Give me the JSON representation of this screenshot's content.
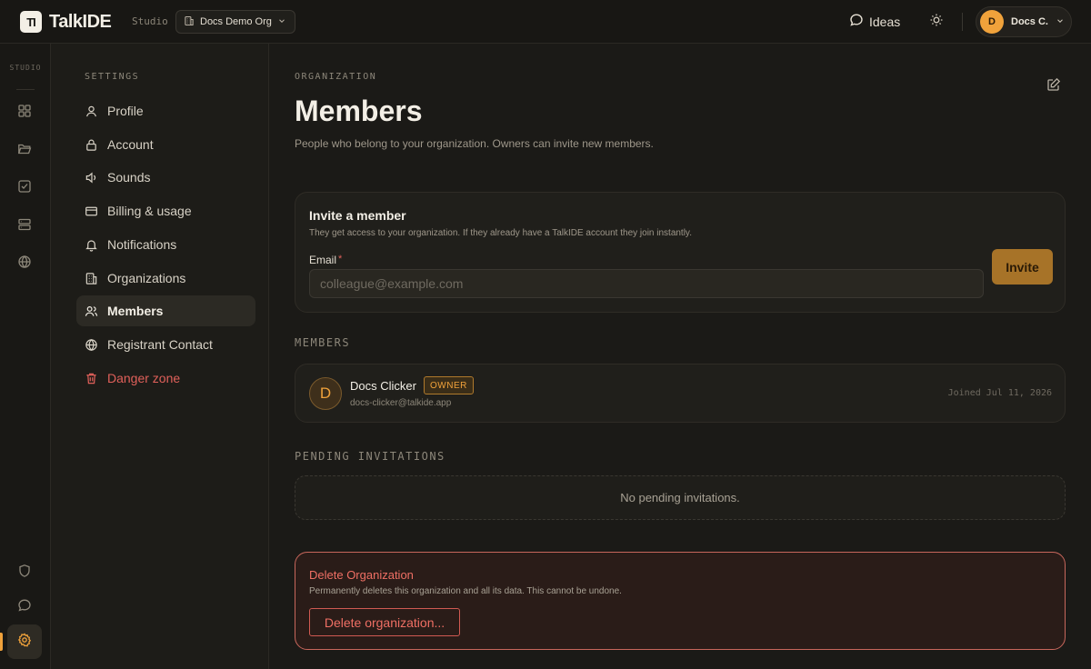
{
  "app": {
    "logo_mark": "TI",
    "name": "TalkIDE",
    "studio_tag": "Studio"
  },
  "header": {
    "org_select": {
      "value": "Docs Demo Org"
    },
    "ideas_label": "Ideas",
    "user": {
      "initial": "D",
      "name": "Docs C."
    }
  },
  "rail": {
    "label": "STUDIO",
    "items": [
      "grid-icon",
      "folder-icon",
      "checkbox-icon",
      "server-icon",
      "globe-icon"
    ],
    "bottom_items": [
      "shield-icon",
      "chat-icon",
      "gear-icon"
    ],
    "active": "gear-icon"
  },
  "settings_nav": {
    "heading": "SETTINGS",
    "items": [
      {
        "label": "Profile",
        "icon": "user-icon"
      },
      {
        "label": "Account",
        "icon": "lock-icon"
      },
      {
        "label": "Sounds",
        "icon": "speaker-icon"
      },
      {
        "label": "Billing & usage",
        "icon": "credit-card-icon"
      },
      {
        "label": "Notifications",
        "icon": "bell-icon"
      },
      {
        "label": "Organizations",
        "icon": "building-icon"
      },
      {
        "label": "Members",
        "icon": "users-icon",
        "active": true
      },
      {
        "label": "Registrant Contact",
        "icon": "globe-icon"
      },
      {
        "label": "Danger zone",
        "icon": "trash-icon",
        "danger": true
      }
    ]
  },
  "main": {
    "eyebrow": "ORGANIZATION",
    "title": "Members",
    "subtitle": "People who belong to your organization. Owners can invite new members.",
    "invite": {
      "title": "Invite a member",
      "subtitle": "They get access to your organization. If they already have a TalkIDE account they join instantly.",
      "email_label": "Email",
      "required_mark": "*",
      "email_placeholder": "colleague@example.com",
      "email_value": "",
      "button_label": "Invite"
    },
    "members_section": {
      "label": "MEMBERS",
      "members": [
        {
          "initial": "D",
          "name": "Docs Clicker",
          "role": "OWNER",
          "email": "docs-clicker@talkide.app",
          "joined": "Joined Jul 11, 2026"
        }
      ]
    },
    "pending_section": {
      "label": "PENDING INVITATIONS",
      "empty_text": "No pending invitations."
    },
    "danger": {
      "title": "Delete Organization",
      "subtitle": "Permanently deletes this organization and all its data. This cannot be undone.",
      "button_label": "Delete organization..."
    }
  },
  "colors": {
    "accent": "#f0a23b",
    "danger": "#ef6f64",
    "background": "#1b1a17"
  }
}
